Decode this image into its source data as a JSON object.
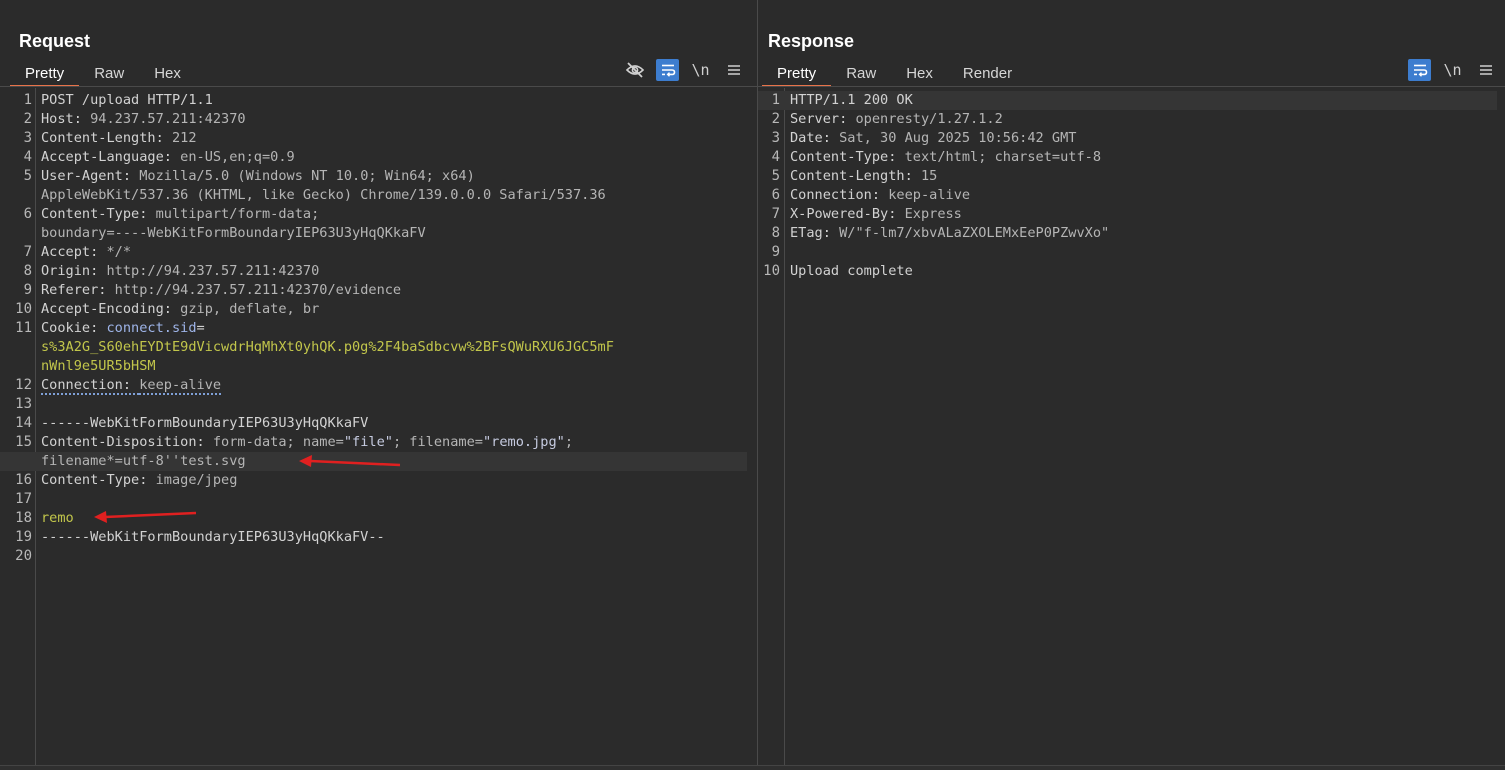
{
  "request": {
    "title": "Request",
    "tabs": [
      "Pretty",
      "Raw",
      "Hex"
    ],
    "active_tab": "Pretty",
    "toolbar": {
      "hide_icon": "eye-slash-icon",
      "wrap_icon": "wrap-lines-icon",
      "newline_label": "\\n",
      "menu_icon": "hamburger-icon"
    },
    "lines": [
      {
        "n": "1",
        "segs": [
          {
            "t": "POST /upload HTTP/1.1",
            "c": "k"
          }
        ]
      },
      {
        "n": "2",
        "segs": [
          {
            "t": "Host: ",
            "c": "k"
          },
          {
            "t": "94.237.57.211:42370",
            "c": "v"
          }
        ]
      },
      {
        "n": "3",
        "segs": [
          {
            "t": "Content-Length: ",
            "c": "k"
          },
          {
            "t": "212",
            "c": "v"
          }
        ]
      },
      {
        "n": "4",
        "segs": [
          {
            "t": "Accept-Language: ",
            "c": "k"
          },
          {
            "t": "en-US,en;q=0.9",
            "c": "v"
          }
        ]
      },
      {
        "n": "5",
        "segs": [
          {
            "t": "User-Agent: ",
            "c": "k"
          },
          {
            "t": "Mozilla/5.0 (Windows NT 10.0; Win64; x64)",
            "c": "v"
          }
        ]
      },
      {
        "n": "",
        "segs": [
          {
            "t": "AppleWebKit/537.36 (KHTML, like Gecko) Chrome/139.0.0.0 Safari/537.36",
            "c": "v"
          }
        ]
      },
      {
        "n": "6",
        "segs": [
          {
            "t": "Content-Type: ",
            "c": "k"
          },
          {
            "t": "multipart/form-data;",
            "c": "v"
          }
        ]
      },
      {
        "n": "",
        "segs": [
          {
            "t": "boundary=----WebKitFormBoundaryIEP63U3yHqQKkaFV",
            "c": "v"
          }
        ]
      },
      {
        "n": "7",
        "segs": [
          {
            "t": "Accept: ",
            "c": "k"
          },
          {
            "t": "*/*",
            "c": "v"
          }
        ]
      },
      {
        "n": "8",
        "segs": [
          {
            "t": "Origin: ",
            "c": "k"
          },
          {
            "t": "http://94.237.57.211:42370",
            "c": "v"
          }
        ]
      },
      {
        "n": "9",
        "segs": [
          {
            "t": "Referer: ",
            "c": "k"
          },
          {
            "t": "http://94.237.57.211:42370/evidence",
            "c": "v"
          }
        ]
      },
      {
        "n": "10",
        "segs": [
          {
            "t": "Accept-Encoding: ",
            "c": "k"
          },
          {
            "t": "gzip, deflate, br",
            "c": "v"
          }
        ]
      },
      {
        "n": "11",
        "segs": [
          {
            "t": "Cookie: ",
            "c": "k"
          },
          {
            "t": "connect.sid",
            "c": "ck"
          },
          {
            "t": "=",
            "c": "k"
          }
        ]
      },
      {
        "n": "",
        "segs": [
          {
            "t": "s%3A2G_S60ehEYDtE9dVicwdrHqMhXt0yhQK.p0g%2F4baSdbcvw%2BFsQWuRXU6JGC5mF",
            "c": "cv"
          }
        ]
      },
      {
        "n": "",
        "segs": [
          {
            "t": "nWnl9e5UR5bHSM",
            "c": "cv"
          }
        ]
      },
      {
        "n": "12",
        "segs": [
          {
            "t": "Connection: ",
            "c": "k u"
          },
          {
            "t": "keep-alive",
            "c": "v u"
          }
        ]
      },
      {
        "n": "13",
        "segs": []
      },
      {
        "n": "14",
        "segs": [
          {
            "t": "------WebKitFormBoundaryIEP63U3yHqQKkaFV",
            "c": "k"
          }
        ]
      },
      {
        "n": "15",
        "segs": [
          {
            "t": "Content-Disposition: ",
            "c": "k"
          },
          {
            "t": "form-data; name=",
            "c": "v"
          },
          {
            "t": "\"file\"",
            "c": "str"
          },
          {
            "t": "; filename=",
            "c": "v"
          },
          {
            "t": "\"remo.jpg\"",
            "c": "str"
          },
          {
            "t": ";",
            "c": "v"
          }
        ]
      },
      {
        "n": "",
        "hl": true,
        "segs": [
          {
            "t": "filename*=utf-8''test.svg",
            "c": "v"
          }
        ]
      },
      {
        "n": "16",
        "segs": [
          {
            "t": "Content-Type: ",
            "c": "k"
          },
          {
            "t": "image/jpeg",
            "c": "v"
          }
        ]
      },
      {
        "n": "17",
        "segs": []
      },
      {
        "n": "18",
        "segs": [
          {
            "t": "remo",
            "c": "cv"
          }
        ]
      },
      {
        "n": "19",
        "segs": [
          {
            "t": "------WebKitFormBoundaryIEP63U3yHqQKkaFV--",
            "c": "k"
          }
        ]
      },
      {
        "n": "20",
        "segs": []
      }
    ]
  },
  "response": {
    "title": "Response",
    "tabs": [
      "Pretty",
      "Raw",
      "Hex",
      "Render"
    ],
    "active_tab": "Pretty",
    "toolbar": {
      "wrap_icon": "wrap-lines-icon",
      "newline_label": "\\n",
      "menu_icon": "hamburger-icon"
    },
    "lines": [
      {
        "n": "1",
        "hl": true,
        "segs": [
          {
            "t": "HTTP/1.1 200 OK",
            "c": "k"
          }
        ]
      },
      {
        "n": "2",
        "segs": [
          {
            "t": "Server: ",
            "c": "k"
          },
          {
            "t": "openresty/1.27.1.2",
            "c": "v"
          }
        ]
      },
      {
        "n": "3",
        "segs": [
          {
            "t": "Date: ",
            "c": "k"
          },
          {
            "t": "Sat, 30 Aug 2025 10:56:42 GMT",
            "c": "v"
          }
        ]
      },
      {
        "n": "4",
        "segs": [
          {
            "t": "Content-Type: ",
            "c": "k"
          },
          {
            "t": "text/html; charset=utf-8",
            "c": "v"
          }
        ]
      },
      {
        "n": "5",
        "segs": [
          {
            "t": "Content-Length: ",
            "c": "k"
          },
          {
            "t": "15",
            "c": "v"
          }
        ]
      },
      {
        "n": "6",
        "segs": [
          {
            "t": "Connection: ",
            "c": "k"
          },
          {
            "t": "keep-alive",
            "c": "v"
          }
        ]
      },
      {
        "n": "7",
        "segs": [
          {
            "t": "X-Powered-By: ",
            "c": "k"
          },
          {
            "t": "Express",
            "c": "v"
          }
        ]
      },
      {
        "n": "8",
        "segs": [
          {
            "t": "ETag: ",
            "c": "k"
          },
          {
            "t": "W/\"f-lm7/xbvALaZXOLEMxEeP0PZwvXo\"",
            "c": "v"
          }
        ]
      },
      {
        "n": "9",
        "segs": []
      },
      {
        "n": "10",
        "segs": [
          {
            "t": "Upload complete",
            "c": "k"
          }
        ]
      }
    ]
  },
  "layout_switch": {
    "icons": [
      "side-by-side-icon",
      "stacked-icon",
      "single-pane-icon"
    ],
    "active": "side-by-side-icon"
  },
  "colors": {
    "accent": "#e8734a",
    "toggle_on": "#3d7dcf",
    "annotation_arrow": "#e02020"
  }
}
